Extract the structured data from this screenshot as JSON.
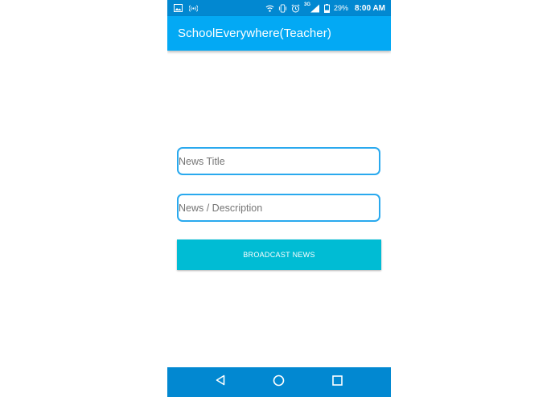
{
  "status_bar": {
    "battery_percent": "29%",
    "time": "8:00 AM",
    "network_type": "3G"
  },
  "app_bar": {
    "title": "SchoolEverywhere(Teacher)"
  },
  "form": {
    "news_title_placeholder": "News Title",
    "news_title_value": "",
    "news_description_placeholder": "News / Description",
    "news_description_value": "",
    "broadcast_button_label": "BROADCAST NEWS"
  },
  "colors": {
    "status_bar": "#0288d1",
    "app_bar": "#03a9f4",
    "field_border": "#29a9ee",
    "button": "#00bcd4",
    "nav_bar": "#0288d1"
  },
  "icons": {
    "status_left": [
      "image-icon",
      "hotspot-icon"
    ],
    "status_right": [
      "wifi-icon",
      "vibrate-icon",
      "alarm-icon",
      "signal-icon",
      "battery-icon"
    ],
    "nav": [
      "back-icon",
      "home-icon",
      "recents-icon"
    ]
  }
}
